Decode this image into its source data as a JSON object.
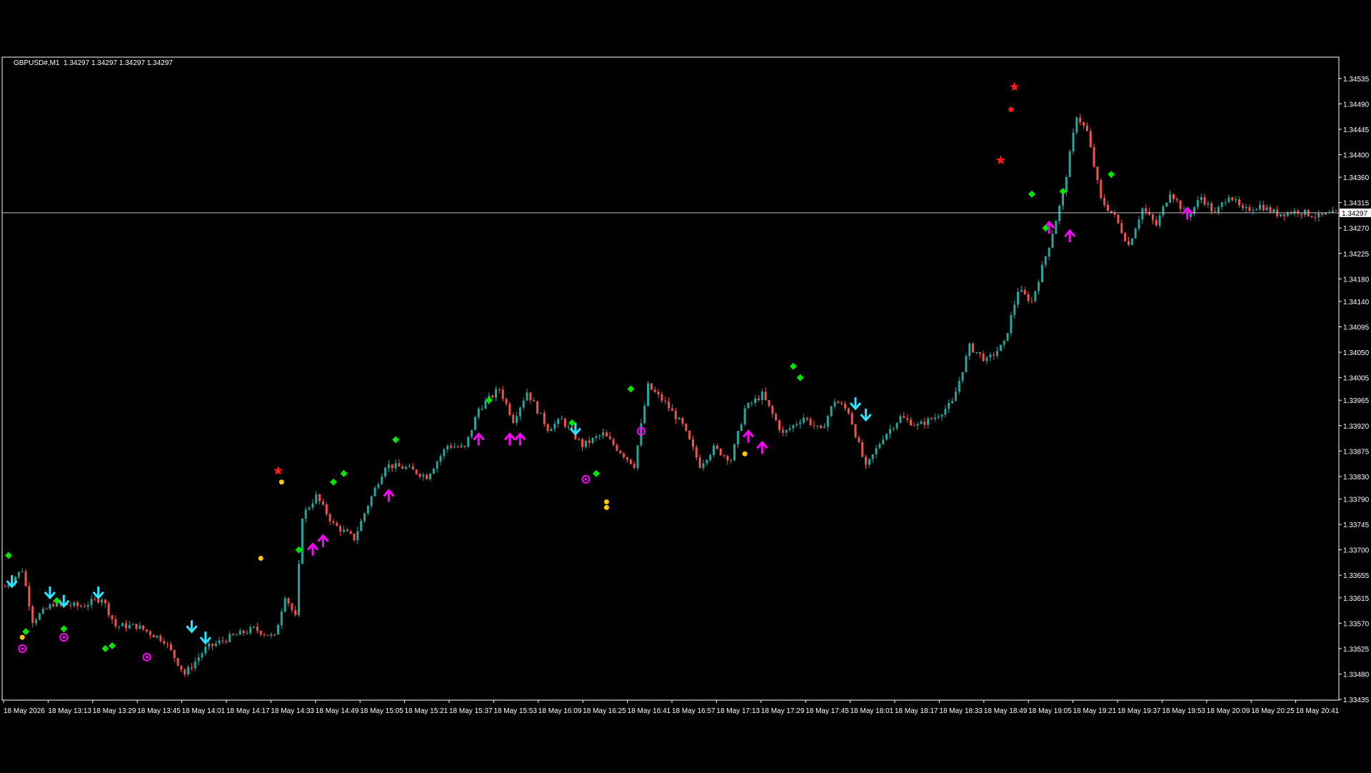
{
  "header": {
    "symbol": "GBPUSD#,M1",
    "ohlc": "1.34297 1.34297 1.34297 1.34297"
  },
  "colors": {
    "background": "#000000",
    "frame": "#ffffff",
    "bull_candle": "#26a69a",
    "bear_candle": "#ef5350",
    "bid_line": "#c0c0c0",
    "arrow_down": "#29e6ff",
    "arrow_up": "#ff00ff",
    "diamond": "#00e600",
    "dot_yellow": "#ffc800",
    "dot_red": "#ff1a1a",
    "star_red": "#ff1a1a",
    "ring_magenta": "#ff00ff"
  },
  "chart_data": {
    "type": "candlestick",
    "instrument": "GBPUSD#",
    "timeframe": "M1",
    "current_price": "1.34297",
    "grid": false,
    "ylim": [
      1.33435,
      1.34555
    ],
    "y_ticks": [
      "1.34535",
      "1.34490",
      "1.34445",
      "1.34400",
      "1.34360",
      "1.34315",
      "1.34270",
      "1.34225",
      "1.34180",
      "1.34140",
      "1.34095",
      "1.34050",
      "1.34005",
      "1.33965",
      "1.33920",
      "1.33875",
      "1.33830",
      "1.33790",
      "1.33745",
      "1.33700",
      "1.33655",
      "1.33615",
      "1.33570",
      "1.33525",
      "1.33480",
      "1.33435"
    ],
    "x_ticks": [
      "18 May 2026",
      "18 May 13:13",
      "18 May 13:29",
      "18 May 13:45",
      "18 May 14:01",
      "18 May 14:17",
      "18 May 14:33",
      "18 May 14:49",
      "18 May 15:05",
      "18 May 15:21",
      "18 May 15:37",
      "18 May 15:53",
      "18 May 16:09",
      "18 May 16:25",
      "18 May 16:41",
      "18 May 16:57",
      "18 May 17:13",
      "18 May 17:29",
      "18 May 17:45",
      "18 May 18:01",
      "18 May 18:17",
      "18 May 18:33",
      "18 May 18:49",
      "18 May 19:05",
      "18 May 19:21",
      "18 May 19:37",
      "18 May 19:53",
      "18 May 20:09",
      "18 May 20:25",
      "18 May 20:41"
    ],
    "price_path": [
      [
        0,
        1.33635
      ],
      [
        5,
        1.33665
      ],
      [
        8,
        1.33575
      ],
      [
        14,
        1.33605
      ],
      [
        22,
        1.336
      ],
      [
        28,
        1.33615
      ],
      [
        32,
        1.33565
      ],
      [
        38,
        1.33565
      ],
      [
        46,
        1.3354
      ],
      [
        52,
        1.3348
      ],
      [
        58,
        1.33525
      ],
      [
        65,
        1.33545
      ],
      [
        72,
        1.3356
      ],
      [
        78,
        1.33545
      ],
      [
        81,
        1.3362
      ],
      [
        84,
        1.3358
      ],
      [
        86,
        1.3376
      ],
      [
        90,
        1.33795
      ],
      [
        95,
        1.33745
      ],
      [
        101,
        1.3372
      ],
      [
        105,
        1.3378
      ],
      [
        110,
        1.3385
      ],
      [
        116,
        1.33845
      ],
      [
        122,
        1.3383
      ],
      [
        128,
        1.33885
      ],
      [
        133,
        1.3388
      ],
      [
        137,
        1.3395
      ],
      [
        143,
        1.33985
      ],
      [
        147,
        1.3393
      ],
      [
        151,
        1.3398
      ],
      [
        157,
        1.33915
      ],
      [
        161,
        1.3393
      ],
      [
        167,
        1.33885
      ],
      [
        173,
        1.33905
      ],
      [
        177,
        1.3388
      ],
      [
        182,
        1.3385
      ],
      [
        186,
        1.3399
      ],
      [
        191,
        1.3396
      ],
      [
        196,
        1.3392
      ],
      [
        201,
        1.3385
      ],
      [
        205,
        1.3388
      ],
      [
        210,
        1.3386
      ],
      [
        214,
        1.3395
      ],
      [
        219,
        1.33975
      ],
      [
        225,
        1.33905
      ],
      [
        231,
        1.33935
      ],
      [
        236,
        1.3391
      ],
      [
        240,
        1.33965
      ],
      [
        244,
        1.33945
      ],
      [
        249,
        1.33845
      ],
      [
        254,
        1.339
      ],
      [
        259,
        1.33935
      ],
      [
        264,
        1.3392
      ],
      [
        269,
        1.33935
      ],
      [
        274,
        1.3396
      ],
      [
        279,
        1.3406
      ],
      [
        284,
        1.34035
      ],
      [
        289,
        1.34065
      ],
      [
        293,
        1.3416
      ],
      [
        297,
        1.3414
      ],
      [
        302,
        1.3424
      ],
      [
        306,
        1.3433
      ],
      [
        310,
        1.3447
      ],
      [
        313,
        1.3444
      ],
      [
        317,
        1.3432
      ],
      [
        321,
        1.3429
      ],
      [
        325,
        1.3424
      ],
      [
        329,
        1.34305
      ],
      [
        333,
        1.34275
      ],
      [
        337,
        1.34335
      ],
      [
        342,
        1.3429
      ],
      [
        346,
        1.34325
      ],
      [
        350,
        1.34295
      ],
      [
        354,
        1.3433
      ],
      [
        358,
        1.343
      ],
      [
        363,
        1.3431
      ],
      [
        368,
        1.34295
      ],
      [
        374,
        1.343
      ],
      [
        380,
        1.3429
      ],
      [
        385,
        1.34297
      ]
    ],
    "bid_line": 1.34297,
    "signals": {
      "arrow_down": [
        [
          2,
          1.33645
        ],
        [
          13,
          1.33625
        ],
        [
          17,
          1.3361
        ],
        [
          27,
          1.33625
        ],
        [
          54,
          1.33565
        ],
        [
          58,
          1.33545
        ],
        [
          165,
          1.33915
        ],
        [
          246,
          1.3396
        ],
        [
          249,
          1.3394
        ]
      ],
      "arrow_up": [
        [
          89,
          1.337
        ],
        [
          92,
          1.33715
        ],
        [
          111,
          1.33795
        ],
        [
          137,
          1.33895
        ],
        [
          146,
          1.33895
        ],
        [
          149,
          1.33895
        ],
        [
          215,
          1.339
        ],
        [
          219,
          1.3388
        ],
        [
          302,
          1.3427
        ],
        [
          308,
          1.34255
        ],
        [
          342,
          1.34295
        ]
      ],
      "diamond": [
        [
          1,
          1.3369
        ],
        [
          6,
          1.33555
        ],
        [
          15,
          1.3361
        ],
        [
          17,
          1.3356
        ],
        [
          29,
          1.33525
        ],
        [
          31,
          1.3353
        ],
        [
          85,
          1.337
        ],
        [
          95,
          1.3382
        ],
        [
          98,
          1.33835
        ],
        [
          113,
          1.33895
        ],
        [
          140,
          1.33965
        ],
        [
          164,
          1.33925
        ],
        [
          171,
          1.33835
        ],
        [
          181,
          1.33985
        ],
        [
          228,
          1.34025
        ],
        [
          230,
          1.34005
        ],
        [
          297,
          1.3433
        ],
        [
          301,
          1.3427
        ],
        [
          306,
          1.34335
        ],
        [
          320,
          1.34365
        ]
      ],
      "dot_yellow": [
        [
          5,
          1.33545
        ],
        [
          74,
          1.33685
        ],
        [
          80,
          1.3382
        ],
        [
          174,
          1.33785
        ],
        [
          174,
          1.33775
        ],
        [
          214,
          1.3387
        ]
      ],
      "dot_red": [
        [
          291,
          1.3448
        ]
      ],
      "star_red": [
        [
          79,
          1.3384
        ],
        [
          288,
          1.3439
        ],
        [
          292,
          1.3452
        ]
      ],
      "ring_magenta": [
        [
          5,
          1.33525
        ],
        [
          17,
          1.33545
        ],
        [
          41,
          1.3351
        ],
        [
          168,
          1.33825
        ],
        [
          184,
          1.3391
        ]
      ]
    }
  }
}
